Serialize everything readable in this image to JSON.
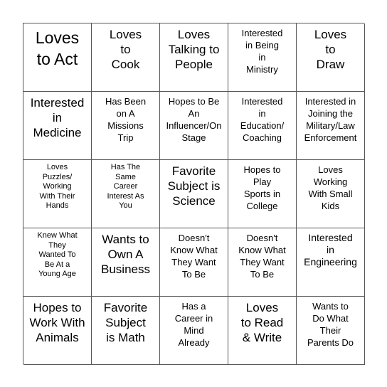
{
  "bingo": {
    "rows": [
      [
        {
          "text": "Loves\nto Act",
          "size": "xl"
        },
        {
          "text": "Loves\nto\nCook",
          "size": "l"
        },
        {
          "text": "Loves\nTalking to\nPeople",
          "size": "l"
        },
        {
          "text": "Interested\nin Being\nin\nMinistry",
          "size": "s"
        },
        {
          "text": "Loves\nto\nDraw",
          "size": "l"
        }
      ],
      [
        {
          "text": "Interested\nin\nMedicine",
          "size": "l"
        },
        {
          "text": "Has Been\non A\nMissions\nTrip",
          "size": "s"
        },
        {
          "text": "Hopes to Be\nAn\nInfluencer/On\nStage",
          "size": "s"
        },
        {
          "text": "Interested\nin\nEducation/\nCoaching",
          "size": "s"
        },
        {
          "text": "Interested in\nJoining the\nMilitary/Law\nEnforcement",
          "size": "s"
        }
      ],
      [
        {
          "text": "Loves\nPuzzles/\nWorking\nWith Their\nHands",
          "size": "xs"
        },
        {
          "text": "Has The\nSame\nCareer\nInterest As\nYou",
          "size": "xs"
        },
        {
          "text": "Favorite\nSubject is\nScience",
          "size": "l"
        },
        {
          "text": "Hopes to\nPlay\nSports in\nCollege",
          "size": "s"
        },
        {
          "text": "Loves\nWorking\nWith Small\nKids",
          "size": "s"
        }
      ],
      [
        {
          "text": "Knew What\nThey\nWanted To\nBe At a\nYoung Age",
          "size": "xs"
        },
        {
          "text": "Wants to\nOwn A\nBusiness",
          "size": "l"
        },
        {
          "text": "Doesn't\nKnow What\nThey Want\nTo Be",
          "size": "s"
        },
        {
          "text": "Doesn't\nKnow What\nThey Want\nTo Be",
          "size": "s"
        },
        {
          "text": "Interested\nin\nEngineering",
          "size": "m"
        }
      ],
      [
        {
          "text": "Hopes to\nWork With\nAnimals",
          "size": "l"
        },
        {
          "text": "Favorite\nSubject\nis Math",
          "size": "l"
        },
        {
          "text": "Has a\nCareer in\nMind\nAlready",
          "size": "s"
        },
        {
          "text": "Loves\nto Read\n& Write",
          "size": "l"
        },
        {
          "text": "Wants to\nDo What\nTheir\nParents Do",
          "size": "s"
        }
      ]
    ]
  }
}
